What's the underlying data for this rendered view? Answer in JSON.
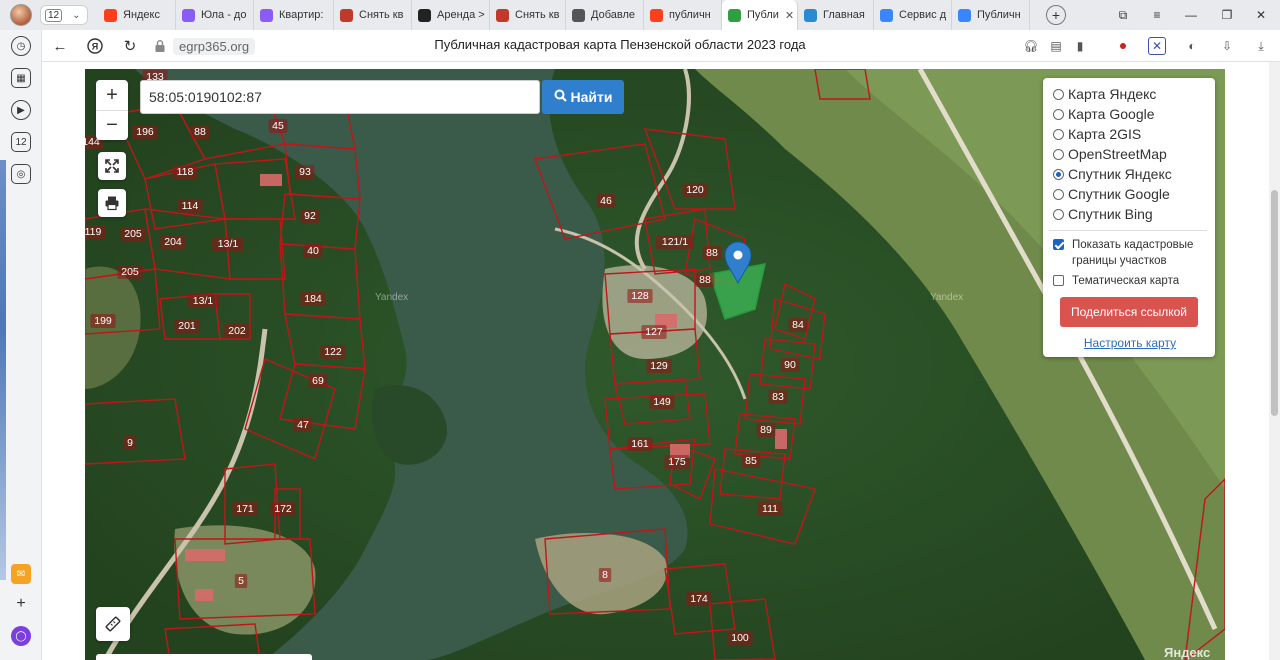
{
  "browser": {
    "tab_count": "12",
    "tabs": [
      {
        "label": "Яндекс",
        "favicon": "yandex-icon",
        "color": "#fc3f1d"
      },
      {
        "label": "Юла - до",
        "favicon": "sparkle-icon",
        "color": "#8a5cf6"
      },
      {
        "label": "Квартир:",
        "favicon": "sparkle-icon",
        "color": "#8a5cf6"
      },
      {
        "label": "Снять кв",
        "favicon": "grid-icon",
        "color": "#c0392b"
      },
      {
        "label": "Аренда >",
        "favicon": "github-icon",
        "color": "#222222"
      },
      {
        "label": "Снять кв",
        "favicon": "grid-icon",
        "color": "#c0392b"
      },
      {
        "label": "Добавле",
        "favicon": "table-icon",
        "color": "#555555"
      },
      {
        "label": "публичн",
        "favicon": "yandex-icon",
        "color": "#fc3f1d"
      },
      {
        "label": "Публи",
        "favicon": "check-shield-icon",
        "color": "#2ea043",
        "active": true
      },
      {
        "label": "Главная",
        "favicon": "map-icon",
        "color": "#2a8bd4"
      },
      {
        "label": "Сервис д",
        "favicon": "sparkle-icon",
        "color": "#3a86ff"
      },
      {
        "label": "Публичн",
        "favicon": "sparkle-icon",
        "color": "#3a86ff"
      }
    ],
    "url_host": "egrp365.org",
    "page_title": "Публичная кадастровая карта Пензенской области 2023 года"
  },
  "map": {
    "search_value": "58:05:0190102:87",
    "search_button": "Найти",
    "zoom_in": "+",
    "zoom_out": "−",
    "watermark": "Yandex",
    "brand": "Яндекс"
  },
  "layers": {
    "options": [
      {
        "label": "Карта Яндекс",
        "checked": false
      },
      {
        "label": "Карта Google",
        "checked": false
      },
      {
        "label": "Карта 2GIS",
        "checked": false
      },
      {
        "label": "OpenStreetMap",
        "checked": false
      },
      {
        "label": "Спутник Яндекс",
        "checked": true
      },
      {
        "label": "Спутник Google",
        "checked": false
      },
      {
        "label": "Спутник Bing",
        "checked": false
      }
    ],
    "show_boundaries": "Показать кадастровые границы участков",
    "show_boundaries_checked": true,
    "thematic_map": "Тематическая карта",
    "thematic_map_checked": false,
    "share_button": "Поделиться ссылкой",
    "setup_link": "Настроить карту"
  },
  "plots": [
    "133",
    "196",
    "88",
    "45",
    "93",
    "118",
    "114",
    "92",
    "119",
    "205",
    "204",
    "13/1",
    "40",
    "205",
    "184",
    "199",
    "201",
    "202",
    "13/1",
    "122",
    "69",
    "47",
    "9",
    "171",
    "172",
    "5",
    "46",
    "120",
    "121/1",
    "88",
    "88",
    "128",
    "127",
    "129",
    "149",
    "161",
    "175",
    "84",
    "90",
    "83",
    "89",
    "85",
    "111",
    "8",
    "174",
    "100",
    "144"
  ]
}
